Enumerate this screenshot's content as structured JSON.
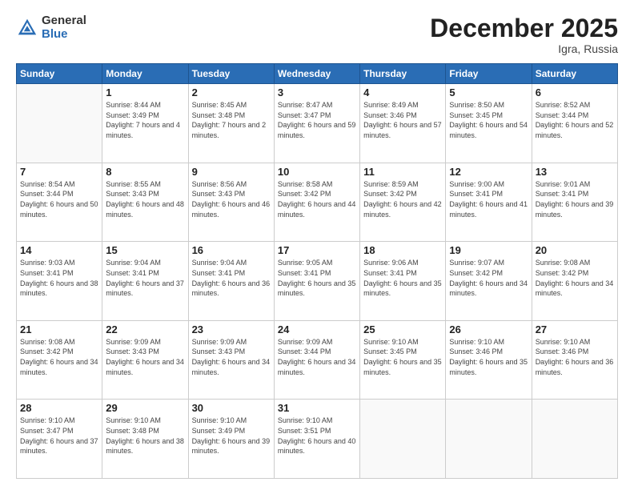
{
  "logo": {
    "general": "General",
    "blue": "Blue"
  },
  "header": {
    "month": "December 2025",
    "location": "Igra, Russia"
  },
  "weekdays": [
    "Sunday",
    "Monday",
    "Tuesday",
    "Wednesday",
    "Thursday",
    "Friday",
    "Saturday"
  ],
  "weeks": [
    [
      {
        "day": "",
        "sunrise": "",
        "sunset": "",
        "daylight": ""
      },
      {
        "day": "1",
        "sunrise": "Sunrise: 8:44 AM",
        "sunset": "Sunset: 3:49 PM",
        "daylight": "Daylight: 7 hours and 4 minutes."
      },
      {
        "day": "2",
        "sunrise": "Sunrise: 8:45 AM",
        "sunset": "Sunset: 3:48 PM",
        "daylight": "Daylight: 7 hours and 2 minutes."
      },
      {
        "day": "3",
        "sunrise": "Sunrise: 8:47 AM",
        "sunset": "Sunset: 3:47 PM",
        "daylight": "Daylight: 6 hours and 59 minutes."
      },
      {
        "day": "4",
        "sunrise": "Sunrise: 8:49 AM",
        "sunset": "Sunset: 3:46 PM",
        "daylight": "Daylight: 6 hours and 57 minutes."
      },
      {
        "day": "5",
        "sunrise": "Sunrise: 8:50 AM",
        "sunset": "Sunset: 3:45 PM",
        "daylight": "Daylight: 6 hours and 54 minutes."
      },
      {
        "day": "6",
        "sunrise": "Sunrise: 8:52 AM",
        "sunset": "Sunset: 3:44 PM",
        "daylight": "Daylight: 6 hours and 52 minutes."
      }
    ],
    [
      {
        "day": "7",
        "sunrise": "Sunrise: 8:54 AM",
        "sunset": "Sunset: 3:44 PM",
        "daylight": "Daylight: 6 hours and 50 minutes."
      },
      {
        "day": "8",
        "sunrise": "Sunrise: 8:55 AM",
        "sunset": "Sunset: 3:43 PM",
        "daylight": "Daylight: 6 hours and 48 minutes."
      },
      {
        "day": "9",
        "sunrise": "Sunrise: 8:56 AM",
        "sunset": "Sunset: 3:43 PM",
        "daylight": "Daylight: 6 hours and 46 minutes."
      },
      {
        "day": "10",
        "sunrise": "Sunrise: 8:58 AM",
        "sunset": "Sunset: 3:42 PM",
        "daylight": "Daylight: 6 hours and 44 minutes."
      },
      {
        "day": "11",
        "sunrise": "Sunrise: 8:59 AM",
        "sunset": "Sunset: 3:42 PM",
        "daylight": "Daylight: 6 hours and 42 minutes."
      },
      {
        "day": "12",
        "sunrise": "Sunrise: 9:00 AM",
        "sunset": "Sunset: 3:41 PM",
        "daylight": "Daylight: 6 hours and 41 minutes."
      },
      {
        "day": "13",
        "sunrise": "Sunrise: 9:01 AM",
        "sunset": "Sunset: 3:41 PM",
        "daylight": "Daylight: 6 hours and 39 minutes."
      }
    ],
    [
      {
        "day": "14",
        "sunrise": "Sunrise: 9:03 AM",
        "sunset": "Sunset: 3:41 PM",
        "daylight": "Daylight: 6 hours and 38 minutes."
      },
      {
        "day": "15",
        "sunrise": "Sunrise: 9:04 AM",
        "sunset": "Sunset: 3:41 PM",
        "daylight": "Daylight: 6 hours and 37 minutes."
      },
      {
        "day": "16",
        "sunrise": "Sunrise: 9:04 AM",
        "sunset": "Sunset: 3:41 PM",
        "daylight": "Daylight: 6 hours and 36 minutes."
      },
      {
        "day": "17",
        "sunrise": "Sunrise: 9:05 AM",
        "sunset": "Sunset: 3:41 PM",
        "daylight": "Daylight: 6 hours and 35 minutes."
      },
      {
        "day": "18",
        "sunrise": "Sunrise: 9:06 AM",
        "sunset": "Sunset: 3:41 PM",
        "daylight": "Daylight: 6 hours and 35 minutes."
      },
      {
        "day": "19",
        "sunrise": "Sunrise: 9:07 AM",
        "sunset": "Sunset: 3:42 PM",
        "daylight": "Daylight: 6 hours and 34 minutes."
      },
      {
        "day": "20",
        "sunrise": "Sunrise: 9:08 AM",
        "sunset": "Sunset: 3:42 PM",
        "daylight": "Daylight: 6 hours and 34 minutes."
      }
    ],
    [
      {
        "day": "21",
        "sunrise": "Sunrise: 9:08 AM",
        "sunset": "Sunset: 3:42 PM",
        "daylight": "Daylight: 6 hours and 34 minutes."
      },
      {
        "day": "22",
        "sunrise": "Sunrise: 9:09 AM",
        "sunset": "Sunset: 3:43 PM",
        "daylight": "Daylight: 6 hours and 34 minutes."
      },
      {
        "day": "23",
        "sunrise": "Sunrise: 9:09 AM",
        "sunset": "Sunset: 3:43 PM",
        "daylight": "Daylight: 6 hours and 34 minutes."
      },
      {
        "day": "24",
        "sunrise": "Sunrise: 9:09 AM",
        "sunset": "Sunset: 3:44 PM",
        "daylight": "Daylight: 6 hours and 34 minutes."
      },
      {
        "day": "25",
        "sunrise": "Sunrise: 9:10 AM",
        "sunset": "Sunset: 3:45 PM",
        "daylight": "Daylight: 6 hours and 35 minutes."
      },
      {
        "day": "26",
        "sunrise": "Sunrise: 9:10 AM",
        "sunset": "Sunset: 3:46 PM",
        "daylight": "Daylight: 6 hours and 35 minutes."
      },
      {
        "day": "27",
        "sunrise": "Sunrise: 9:10 AM",
        "sunset": "Sunset: 3:46 PM",
        "daylight": "Daylight: 6 hours and 36 minutes."
      }
    ],
    [
      {
        "day": "28",
        "sunrise": "Sunrise: 9:10 AM",
        "sunset": "Sunset: 3:47 PM",
        "daylight": "Daylight: 6 hours and 37 minutes."
      },
      {
        "day": "29",
        "sunrise": "Sunrise: 9:10 AM",
        "sunset": "Sunset: 3:48 PM",
        "daylight": "Daylight: 6 hours and 38 minutes."
      },
      {
        "day": "30",
        "sunrise": "Sunrise: 9:10 AM",
        "sunset": "Sunset: 3:49 PM",
        "daylight": "Daylight: 6 hours and 39 minutes."
      },
      {
        "day": "31",
        "sunrise": "Sunrise: 9:10 AM",
        "sunset": "Sunset: 3:51 PM",
        "daylight": "Daylight: 6 hours and 40 minutes."
      },
      {
        "day": "",
        "sunrise": "",
        "sunset": "",
        "daylight": ""
      },
      {
        "day": "",
        "sunrise": "",
        "sunset": "",
        "daylight": ""
      },
      {
        "day": "",
        "sunrise": "",
        "sunset": "",
        "daylight": ""
      }
    ]
  ]
}
